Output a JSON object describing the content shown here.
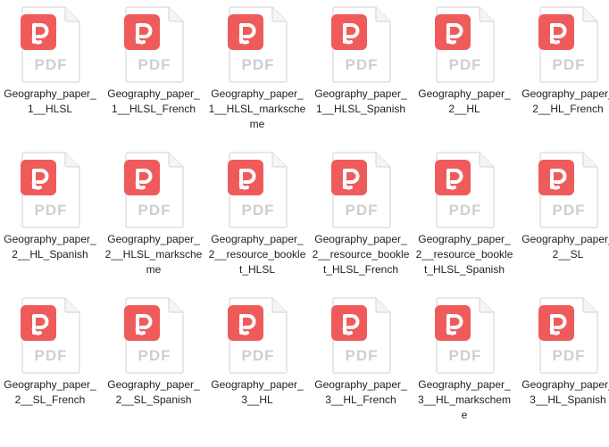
{
  "view": {
    "icon_type": "pdf-file-icon",
    "icon_label": "PDF",
    "colors": {
      "brand_red": "#ef5b5b",
      "page_fill": "#ffffff",
      "page_stroke": "#d9d9d9",
      "pdf_text": "#cfcfcf"
    }
  },
  "files": [
    {
      "name": "Geography_paper_1__HLSL"
    },
    {
      "name": "Geography_paper_1__HLSL_French"
    },
    {
      "name": "Geography_paper_1__HLSL_markscheme"
    },
    {
      "name": "Geography_paper_1__HLSL_Spanish"
    },
    {
      "name": "Geography_paper_2__HL"
    },
    {
      "name": "Geography_paper_2__HL_French"
    },
    {
      "name": "Geography_paper_2__HL_Spanish"
    },
    {
      "name": "Geography_paper_2__HLSL_markscheme"
    },
    {
      "name": "Geography_paper_2__resource_booklet_HLSL"
    },
    {
      "name": "Geography_paper_2__resource_booklet_HLSL_French"
    },
    {
      "name": "Geography_paper_2__resource_booklet_HLSL_Spanish"
    },
    {
      "name": "Geography_paper_2__SL"
    },
    {
      "name": "Geography_paper_2__SL_French"
    },
    {
      "name": "Geography_paper_2__SL_Spanish"
    },
    {
      "name": "Geography_paper_3__HL"
    },
    {
      "name": "Geography_paper_3__HL_French"
    },
    {
      "name": "Geography_paper_3__HL_markscheme"
    },
    {
      "name": "Geography_paper_3__HL_Spanish"
    }
  ]
}
